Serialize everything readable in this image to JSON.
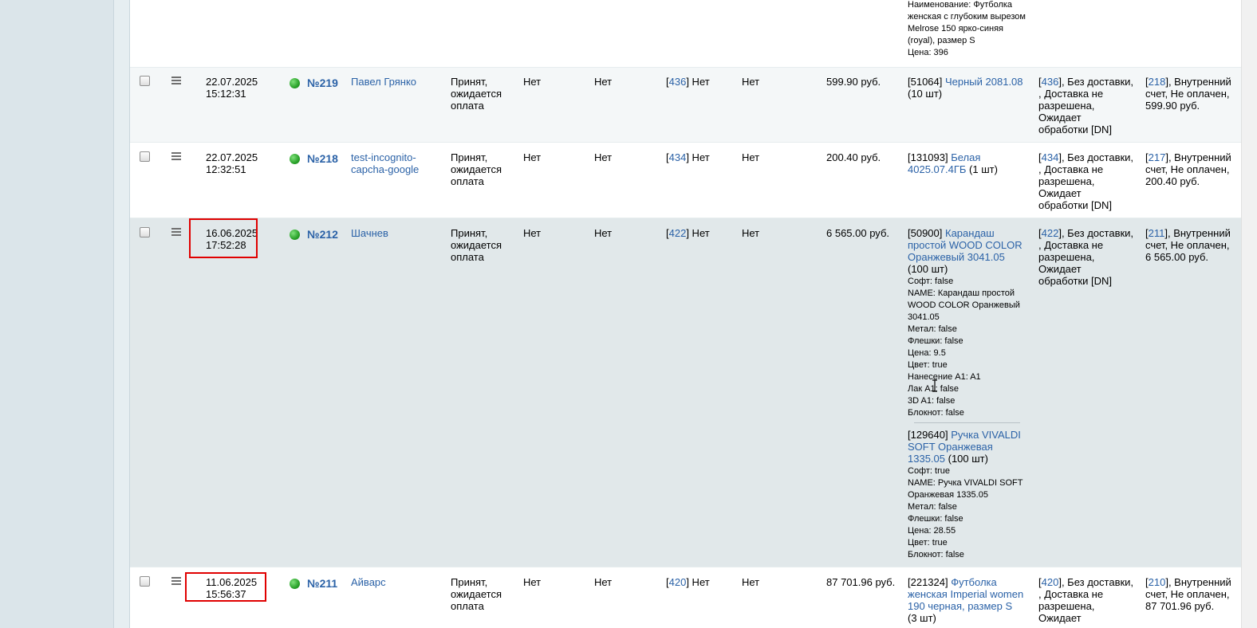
{
  "top_fragment": {
    "lines": [
      "Наименование: Футболка",
      "женская с глубоким вырезом",
      "Melrose 150 ярко-синяя",
      "(royal), размер S",
      "Цена: 396"
    ]
  },
  "orders": [
    {
      "date": "22.07.2025",
      "time": "15:12:31",
      "number": "№219",
      "customer": [
        "Павел Грянко"
      ],
      "status": [
        "Принят,",
        "ожидается",
        "оплата"
      ],
      "col_a": "Нет",
      "col_b": "Нет",
      "pay_id": "436",
      "pay_text": "] Нет",
      "col_c": "Нет",
      "sum": "599.90 руб.",
      "items": [
        {
          "id": "[51064] ",
          "name": [
            "Черный 2081.08"
          ],
          "qty": "(10 шт)",
          "props": []
        }
      ],
      "delivery_id": "436",
      "delivery": [
        "], Без доставки,",
        ", Доставка не",
        "разрешена,",
        "Ожидает",
        "обработки [DN]"
      ],
      "invoice_id": "218",
      "invoice": [
        "], Внутренний",
        "счет, Не оплачен,",
        "599.90 руб."
      ]
    },
    {
      "date": "22.07.2025",
      "time": "12:32:51",
      "number": "№218",
      "customer": [
        "test-incognito-",
        "capcha-google"
      ],
      "status": [
        "Принят,",
        "ожидается",
        "оплата"
      ],
      "col_a": "Нет",
      "col_b": "Нет",
      "pay_id": "434",
      "pay_text": "] Нет",
      "col_c": "Нет",
      "sum": "200.40 руб.",
      "items": [
        {
          "id": "[131093] ",
          "name": [
            "Белая",
            "4025.07.4ГБ"
          ],
          "qty": " (1 шт)",
          "props": []
        }
      ],
      "delivery_id": "434",
      "delivery": [
        "], Без доставки,",
        ", Доставка не",
        "разрешена,",
        "Ожидает",
        "обработки [DN]"
      ],
      "invoice_id": "217",
      "invoice": [
        "], Внутренний",
        "счет, Не оплачен,",
        "200.40 руб."
      ]
    },
    {
      "date": "16.06.2025",
      "time": "17:52:28",
      "number": "№212",
      "customer": [
        "Шачнев"
      ],
      "status": [
        "Принят,",
        "ожидается",
        "оплата"
      ],
      "col_a": "Нет",
      "col_b": "Нет",
      "pay_id": "422",
      "pay_text": "] Нет",
      "col_c": "Нет",
      "sum": "6 565.00 руб.",
      "items": [
        {
          "id": "[50900] ",
          "name": [
            "Карандаш",
            "простой WOOD COLOR",
            "Оранжевый 3041.05"
          ],
          "qty": "(100 шт)",
          "props": [
            "Софт: false",
            "NAME: Карандаш простой",
            "WOOD COLOR Оранжевый",
            "3041.05",
            "Метал: false",
            "Флешки: false",
            "Цена: 9.5",
            "Цвет: true",
            "Нанесение A1: A1",
            "Лак A1: false",
            "3D A1: false",
            "Блокнот: false"
          ]
        },
        {
          "id": "[129640] ",
          "name": [
            "Ручка VIVALDI",
            "SOFT Оранжевая",
            "1335.05"
          ],
          "qty": " (100 шт)",
          "props": [
            "Софт: true",
            "NAME: Ручка VIVALDI SOFT",
            "Оранжевая 1335.05",
            "Метал: false",
            "Флешки: false",
            "Цена: 28.55",
            "Цвет: true",
            "Блокнот: false"
          ]
        }
      ],
      "delivery_id": "422",
      "delivery": [
        "], Без доставки,",
        ", Доставка не",
        "разрешена,",
        "Ожидает",
        "обработки [DN]"
      ],
      "invoice_id": "211",
      "invoice": [
        "], Внутренний",
        "счет, Не оплачен,",
        "6 565.00 руб."
      ]
    },
    {
      "date": "11.06.2025",
      "time": "15:56:37",
      "number": "№211",
      "customer": [
        "Айварс"
      ],
      "status": [
        "Принят,",
        "ожидается",
        "оплата"
      ],
      "col_a": "Нет",
      "col_b": "Нет",
      "pay_id": "420",
      "pay_text": "] Нет",
      "col_c": "Нет",
      "sum": "87 701.96 руб.",
      "items": [
        {
          "id": "[221324] ",
          "name": [
            "Футболка",
            "женская Imperial women",
            "190 черная, размер S"
          ],
          "qty": "(3 шт)",
          "props": []
        }
      ],
      "delivery_id": "420",
      "delivery": [
        "], Без доставки,",
        ", Доставка не",
        "разрешена,",
        "Ожидает"
      ],
      "invoice_id": "210",
      "invoice": [
        "], Внутренний",
        "счет, Не оплачен,",
        "87 701.96 руб."
      ]
    }
  ]
}
